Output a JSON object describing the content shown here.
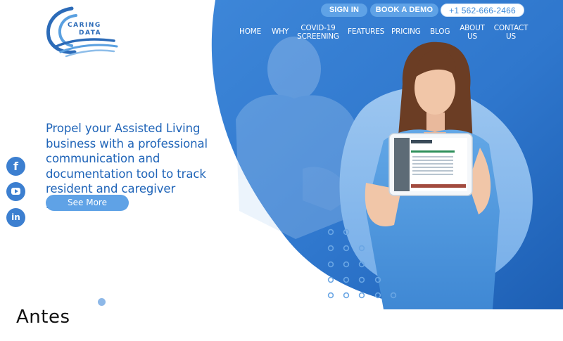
{
  "logo": {
    "line1": "CARING",
    "line2": "DATA"
  },
  "topbar": {
    "sign_in": "SIGN IN",
    "book_demo": "BOOK A DEMO",
    "phone": "+1 562-666-2466"
  },
  "nav": {
    "home": "HOME",
    "why": "WHY",
    "covid_1": "COVID-19",
    "covid_2": "SCREENING",
    "features": "FEATURES",
    "pricing": "PRICING",
    "blog": "BLOG",
    "about_1": "ABOUT",
    "about_2": "US",
    "contact_1": "CONTACT",
    "contact_2": "US"
  },
  "hero": {
    "headline": "Propel your Assisted Living business with a professional communication and documentation tool to track resident and caregiver information.",
    "cta": "See More"
  },
  "social": {
    "facebook": "f",
    "linkedin": "in"
  },
  "icons": {
    "facebook": "facebook-icon",
    "youtube": "youtube-icon",
    "linkedin": "linkedin-icon"
  },
  "caption": "Antes",
  "colors": {
    "primary": "#1f64b8",
    "accent": "#5fa2e6",
    "hero_bg": "#2f78cf",
    "dots": "#6aa6e4"
  }
}
